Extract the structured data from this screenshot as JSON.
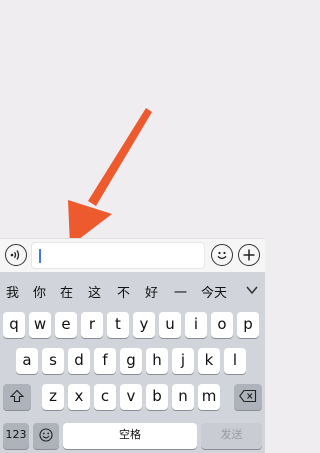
{
  "input_bar": {
    "voice_icon": "voice-input-icon",
    "input_value": "",
    "emoji_icon": "emoji-icon",
    "plus_icon": "plus-icon"
  },
  "annotation": {
    "icon": "arrow-pointer",
    "color": "#ec5a2e"
  },
  "candidates": [
    "我",
    "你",
    "在",
    "这",
    "不",
    "好",
    "一",
    "今天"
  ],
  "keyboard": {
    "row1": [
      "q",
      "w",
      "e",
      "r",
      "t",
      "y",
      "u",
      "i",
      "o",
      "p"
    ],
    "row2": [
      "a",
      "s",
      "d",
      "f",
      "g",
      "h",
      "j",
      "k",
      "l"
    ],
    "row3": [
      "z",
      "x",
      "c",
      "v",
      "b",
      "n",
      "m"
    ],
    "numbers_label": "123",
    "space_label": "空格",
    "send_label": "发送"
  }
}
